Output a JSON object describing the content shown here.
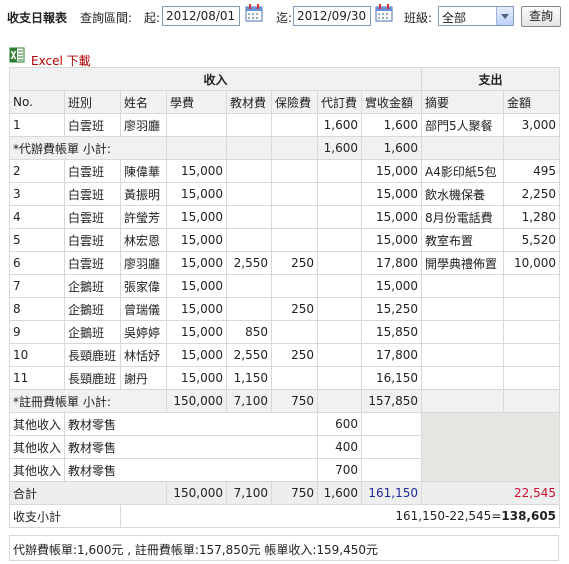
{
  "toolbar": {
    "title": "收支日報表",
    "range_label": "查詢區間:",
    "start_label": "起:",
    "start_value": "2012/08/01",
    "end_label": "迄:",
    "end_value": "2012/09/30",
    "class_label": "班級:",
    "class_value": "全部",
    "query_button": "查詢"
  },
  "excel_link": "Excel 下載",
  "headers": {
    "income": "收入",
    "expense": "支出",
    "columns": [
      "No.",
      "班別",
      "姓名",
      "學費",
      "教材費",
      "保險費",
      "代訂費",
      "實收金額",
      "摘要",
      "金額"
    ]
  },
  "rows": [
    {
      "no": "1",
      "cls": "白雲班",
      "name": "廖羽廳",
      "tuition": "",
      "material": "",
      "insurance": "",
      "proxy": "1,600",
      "received": "1,600",
      "desc": "部門5人聚餐",
      "amount": "3,000"
    },
    {
      "subtotal_label": "*代辦費帳單 小計:",
      "proxy": "1,600",
      "received": "1,600"
    },
    {
      "no": "2",
      "cls": "白雲班",
      "name": "陳偉華",
      "tuition": "15,000",
      "material": "",
      "insurance": "",
      "proxy": "",
      "received": "15,000",
      "desc": "A4影印紙5包",
      "amount": "495"
    },
    {
      "no": "3",
      "cls": "白雲班",
      "name": "黃振明",
      "tuition": "15,000",
      "material": "",
      "insurance": "",
      "proxy": "",
      "received": "15,000",
      "desc": "飲水機保養",
      "amount": "2,250"
    },
    {
      "no": "4",
      "cls": "白雲班",
      "name": "許瑩芳",
      "tuition": "15,000",
      "material": "",
      "insurance": "",
      "proxy": "",
      "received": "15,000",
      "desc": "8月份電話費",
      "amount": "1,280"
    },
    {
      "no": "5",
      "cls": "白雲班",
      "name": "林宏恩",
      "tuition": "15,000",
      "material": "",
      "insurance": "",
      "proxy": "",
      "received": "15,000",
      "desc": "教室布置",
      "amount": "5,520"
    },
    {
      "no": "6",
      "cls": "白雲班",
      "name": "廖羽廳",
      "tuition": "15,000",
      "material": "2,550",
      "insurance": "250",
      "proxy": "",
      "received": "17,800",
      "desc": "開學典禮佈置",
      "amount": "10,000"
    },
    {
      "no": "7",
      "cls": "企鵝班",
      "name": "張家偉",
      "tuition": "15,000",
      "material": "",
      "insurance": "",
      "proxy": "",
      "received": "15,000",
      "desc": "",
      "amount": ""
    },
    {
      "no": "8",
      "cls": "企鵝班",
      "name": "曾瑞儀",
      "tuition": "15,000",
      "material": "",
      "insurance": "250",
      "proxy": "",
      "received": "15,250",
      "desc": "",
      "amount": ""
    },
    {
      "no": "9",
      "cls": "企鵝班",
      "name": "吳婷婷",
      "tuition": "15,000",
      "material": "850",
      "insurance": "",
      "proxy": "",
      "received": "15,850",
      "desc": "",
      "amount": ""
    },
    {
      "no": "10",
      "cls": "長頸鹿班",
      "name": "林恬妤",
      "tuition": "15,000",
      "material": "2,550",
      "insurance": "250",
      "proxy": "",
      "received": "17,800",
      "desc": "",
      "amount": ""
    },
    {
      "no": "11",
      "cls": "長頸鹿班",
      "name": "謝丹",
      "tuition": "15,000",
      "material": "1,150",
      "insurance": "",
      "proxy": "",
      "received": "16,150",
      "desc": "",
      "amount": ""
    },
    {
      "subtotal_label": "*註冊費帳單 小計:",
      "tuition": "150,000",
      "material": "7,100",
      "insurance": "750",
      "received": "157,850"
    }
  ],
  "other_income": [
    {
      "type": "其他收入",
      "item": "教材零售",
      "value": "600"
    },
    {
      "type": "其他收入",
      "item": "教材零售",
      "value": "400"
    },
    {
      "type": "其他收入",
      "item": "教材零售",
      "value": "700"
    }
  ],
  "total": {
    "label": "合計",
    "tuition": "150,000",
    "material": "7,100",
    "insurance": "750",
    "proxy": "1,600",
    "received": "161,150",
    "expense": "22,545"
  },
  "balance": {
    "label": "收支小計",
    "formula": "161,150-22,545=",
    "result": "138,605"
  },
  "footer": "代辦費帳單:1,600元 , 註冊費帳單:157,850元 帳單收入:159,450元",
  "colors": {
    "excel_text": "#b00000",
    "received_total": "#1a2a9c",
    "expense_total": "#c8102e"
  },
  "icons": [
    "calendar-icon",
    "excel-icon",
    "dropdown-arrow-icon"
  ]
}
